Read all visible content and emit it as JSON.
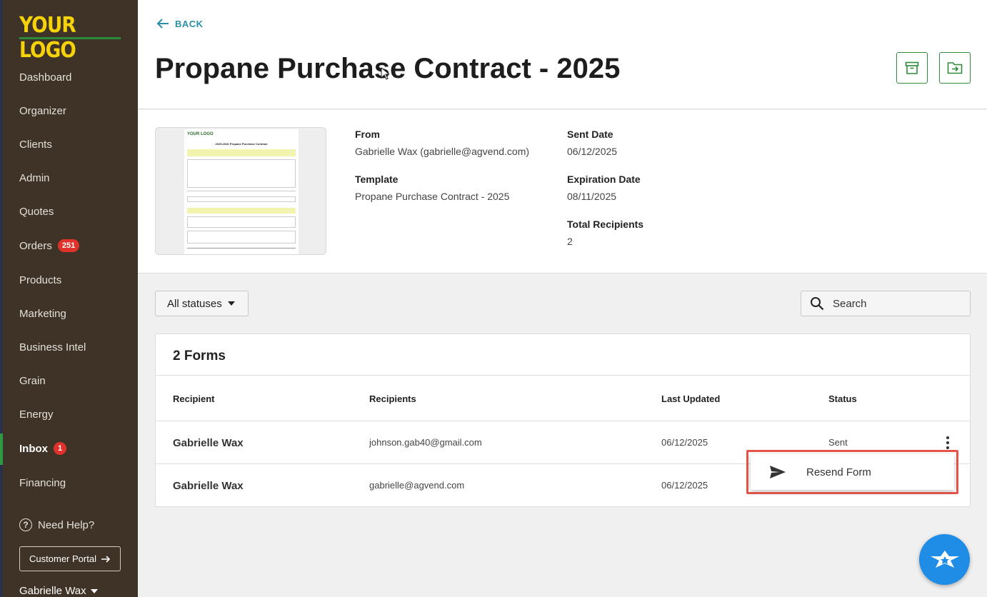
{
  "sidebar": {
    "logo": "YOUR LOGO",
    "items": [
      {
        "label": "Dashboard"
      },
      {
        "label": "Organizer"
      },
      {
        "label": "Clients"
      },
      {
        "label": "Admin"
      },
      {
        "label": "Quotes"
      },
      {
        "label": "Orders",
        "badge": "251"
      },
      {
        "label": "Products"
      },
      {
        "label": "Marketing"
      },
      {
        "label": "Business Intel"
      },
      {
        "label": "Grain"
      },
      {
        "label": "Energy"
      },
      {
        "label": "Inbox",
        "badge": "1",
        "active": true
      },
      {
        "label": "Financing"
      }
    ],
    "help": "Need Help?",
    "portal_button": "Customer Portal",
    "user": "Gabrielle Wax"
  },
  "header": {
    "back": "BACK",
    "title": "Propane Purchase Contract - 2025"
  },
  "details": {
    "from_label": "From",
    "from_value": "Gabrielle Wax (gabrielle@agvend.com)",
    "template_label": "Template",
    "template_value": "Propane Purchase Contract - 2025",
    "sent_label": "Sent Date",
    "sent_value": "06/12/2025",
    "expiration_label": "Expiration Date",
    "expiration_value": "08/11/2025",
    "recipients_label": "Total Recipients",
    "recipients_value": "2",
    "thumb_logo": "YOUR LOGO",
    "thumb_title": "2025-2026 Propane Purchase Contract"
  },
  "filters": {
    "status": "All statuses",
    "search_placeholder": "Search"
  },
  "forms": {
    "title": "2 Forms",
    "columns": [
      "Recipient",
      "Recipients",
      "Last Updated",
      "Status"
    ],
    "rows": [
      {
        "name": "Gabrielle Wax",
        "email": "johnson.gab40@gmail.com",
        "updated": "06/12/2025",
        "status": "Sent"
      },
      {
        "name": "Gabrielle Wax",
        "email": "gabrielle@agvend.com",
        "updated": "06/12/2025",
        "status": ""
      }
    ]
  },
  "menu": {
    "resend": "Resend Form"
  },
  "colors": {
    "sidebar_bg": "#3e3326",
    "logo": "#f5d20a",
    "accent_green": "#2e8b3a",
    "link_teal": "#2b8fa8",
    "badge_red": "#e0312b",
    "fab_blue": "#1f8ce6"
  }
}
